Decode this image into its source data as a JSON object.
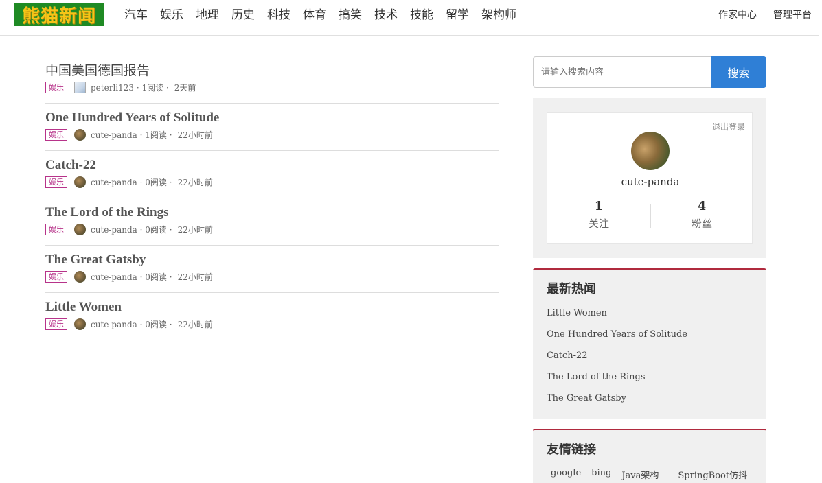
{
  "header": {
    "logo_text": "熊猫新闻",
    "nav": [
      "汽车",
      "娱乐",
      "地理",
      "历史",
      "科技",
      "体育",
      "搞笑",
      "技术",
      "技能",
      "留学",
      "架构师"
    ],
    "writer_center": "作家中心",
    "admin_platform": "管理平台"
  },
  "articles": [
    {
      "title": "中国美国德国报告",
      "tag": "娱乐",
      "author": "peterli123",
      "reads": "· 1阅读 ·",
      "time": "2天前"
    },
    {
      "title": "One Hundred Years of Solitude",
      "tag": "娱乐",
      "author": "cute-panda",
      "reads": "· 1阅读 ·",
      "time": "22小时前"
    },
    {
      "title": "Catch-22",
      "tag": "娱乐",
      "author": "cute-panda",
      "reads": "· 0阅读 ·",
      "time": "22小时前"
    },
    {
      "title": "The Lord of the Rings",
      "tag": "娱乐",
      "author": "cute-panda",
      "reads": "· 0阅读 ·",
      "time": "22小时前"
    },
    {
      "title": "The Great Gatsby",
      "tag": "娱乐",
      "author": "cute-panda",
      "reads": "· 0阅读 ·",
      "time": "22小时前"
    },
    {
      "title": "Little Women",
      "tag": "娱乐",
      "author": "cute-panda",
      "reads": "· 0阅读 ·",
      "time": "22小时前"
    }
  ],
  "search": {
    "placeholder": "请输入搜索内容",
    "button": "搜索"
  },
  "user": {
    "logout": "退出登录",
    "name": "cute-panda",
    "following_count": "1",
    "following_label": "关注",
    "followers_count": "4",
    "followers_label": "粉丝"
  },
  "hot": {
    "title": "最新热闻",
    "items": [
      "Little Women",
      "One Hundred Years of Solitude",
      "Catch-22",
      "The Lord of the Rings",
      "The Great Gatsby"
    ]
  },
  "links": {
    "title": "友情链接",
    "items": [
      "google",
      "bing",
      "Java架构师",
      "SpringBoot仿抖音"
    ]
  },
  "colors": {
    "logo_bg": "#1f8a24",
    "logo_text": "#f5c518",
    "tag": "#b7338a",
    "search_button": "#2f7fd6",
    "panel_accent": "#b02a3e"
  }
}
